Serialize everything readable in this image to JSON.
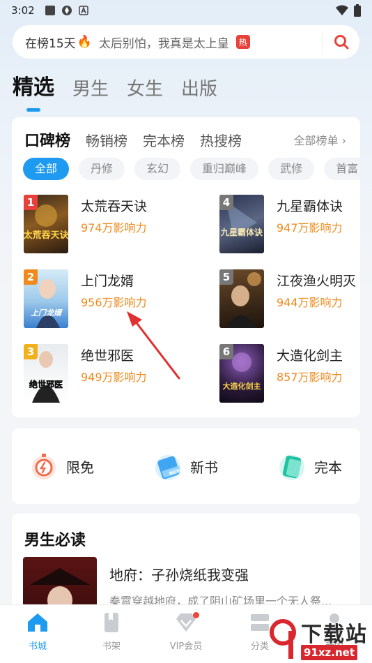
{
  "status_bar": {
    "time": "3:02"
  },
  "search": {
    "keyword": "在榜15天",
    "fire": "🔥",
    "suggestion": "太后别怕，我真是太上皇",
    "hot_badge": "热"
  },
  "top_tabs": [
    "精选",
    "男生",
    "女生",
    "出版"
  ],
  "rank_tabs": [
    "口碑榜",
    "畅销榜",
    "完本榜",
    "热搜榜"
  ],
  "all_rank_label": "全部榜单 ›",
  "chips": [
    "全部",
    "丹修",
    "玄幻",
    "重归巅峰",
    "武修",
    "首富"
  ],
  "books": [
    {
      "rank": "1",
      "title": "太荒吞天诀",
      "influence": "974万影响力",
      "cover_text": "太荒吞天诀",
      "badge_color": "#e8413b"
    },
    {
      "rank": "2",
      "title": "上门龙婿",
      "influence": "956万影响力",
      "cover_text": "上门龙婿",
      "badge_color": "#f08a1c"
    },
    {
      "rank": "3",
      "title": "绝世邪医",
      "influence": "949万影响力",
      "cover_text": "绝世邪医",
      "badge_color": "#f0b11c"
    },
    {
      "rank": "4",
      "title": "九星霸体诀",
      "influence": "947万影响力",
      "cover_text": "九星霸体诀",
      "badge_color": "#777777"
    },
    {
      "rank": "5",
      "title": "江夜渔火明灭",
      "influence": "944万影响力",
      "cover_text": "",
      "badge_color": "#777777"
    },
    {
      "rank": "6",
      "title": "大造化剑主",
      "influence": "857万影响力",
      "cover_text": "大造化剑主",
      "badge_color": "#777777"
    }
  ],
  "quick": [
    {
      "label": "限免",
      "icon": "stopwatch-icon"
    },
    {
      "label": "新书",
      "icon": "new-book-icon"
    },
    {
      "label": "完本",
      "icon": "finished-book-icon"
    }
  ],
  "must_read": {
    "title": "男生必读",
    "book_title": "地府：子孙烧纸我变强",
    "description": "秦霄穿越地府，成了阴山矿场里一个无人祭..."
  },
  "bottom_nav": [
    {
      "label": "书城",
      "icon": "house-icon"
    },
    {
      "label": "书架",
      "icon": "bookshelf-icon"
    },
    {
      "label": "VIP会员",
      "icon": "vip-diamond-icon"
    },
    {
      "label": "分类",
      "icon": "category-icon"
    },
    {
      "label": "我的",
      "icon": "profile-icon"
    }
  ],
  "watermark": {
    "title": "下载站",
    "site": "91xz.net"
  },
  "colors": {
    "accent": "#1e9bf0",
    "influence": "#ef8a1c",
    "annotation_arrow": "#e03030"
  }
}
